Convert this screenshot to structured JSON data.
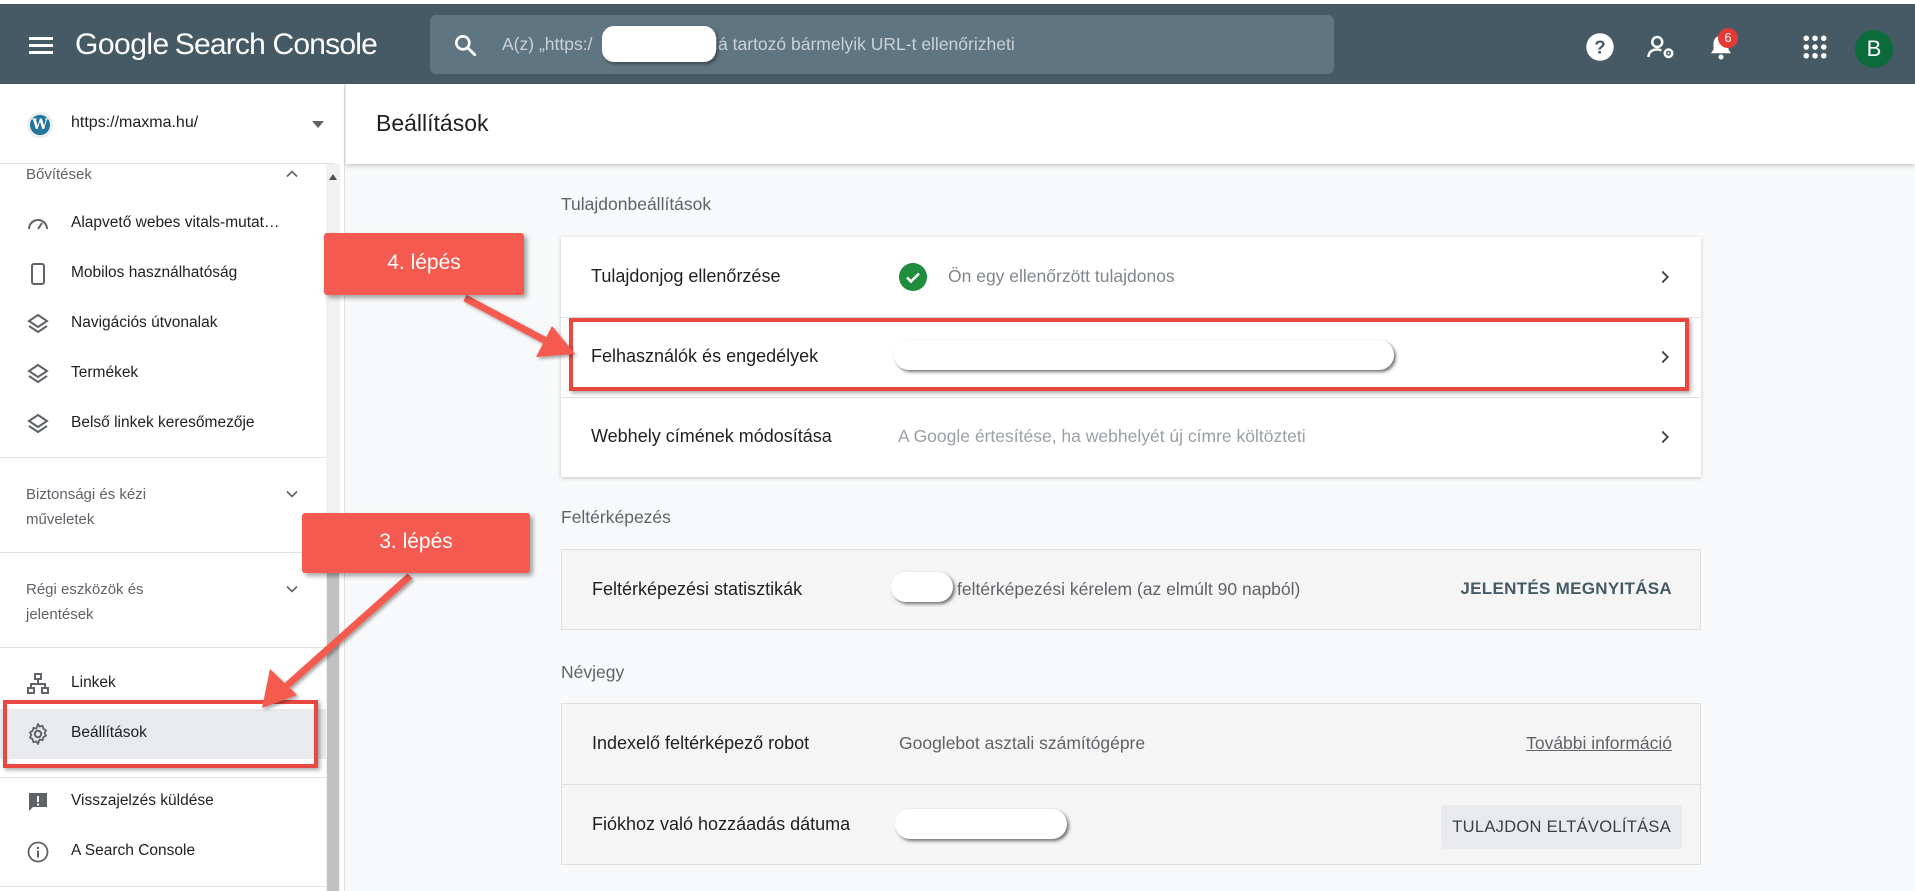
{
  "app": {
    "logo_google": "Google",
    "logo_product": "Search Console"
  },
  "search": {
    "placeholder_prefix": "A(z) „https:/",
    "placeholder_suffix": "alá tartozó bármelyik URL-t ellenőrizheti"
  },
  "header_icons": {
    "help": "help-icon",
    "admin": "user-settings-icon",
    "notifications": "bell-icon",
    "notification_count": "6",
    "apps": "apps-grid-icon",
    "avatar_letter": "B"
  },
  "sidebar": {
    "property_url": "https://maxma.hu/",
    "sections": {
      "extensions": "Bővítések",
      "security": "Biztonsági és kézi műveletek",
      "legacy": "Régi eszközök és jelentések"
    },
    "items": [
      {
        "label": "Alapvető webes vitals-mutat…",
        "icon": "speed-icon"
      },
      {
        "label": "Mobilos használhatóság",
        "icon": "phone-icon"
      },
      {
        "label": "Navigációs útvonalak",
        "icon": "layers-icon"
      },
      {
        "label": "Termékek",
        "icon": "layers-icon"
      },
      {
        "label": "Belső linkek keresőmezője",
        "icon": "layers-icon"
      },
      {
        "label": "Linkek",
        "icon": "sitemap-icon"
      },
      {
        "label": "Beállítások",
        "icon": "gear-icon",
        "active": true
      },
      {
        "label": "Visszajelzés küldése",
        "icon": "feedback-icon"
      },
      {
        "label": "A Search Console",
        "icon": "info-icon"
      }
    ]
  },
  "page": {
    "title": "Beállítások"
  },
  "groups": {
    "property": {
      "title": "Tulajdonbeállítások",
      "rows": [
        {
          "label": "Tulajdonjog ellenőrzése",
          "value": "Ön egy ellenőrzött tulajdonos"
        },
        {
          "label": "Felhasználók és engedélyek",
          "value": ""
        },
        {
          "label": "Webhely címének módosítása",
          "value": "A Google értesítése, ha webhelyét új címre költözteti"
        }
      ]
    },
    "crawl": {
      "title": "Feltérképezés",
      "rows": [
        {
          "label": "Feltérképezési statisztikák",
          "value": "feltérképezési kérelem (az elmúlt 90 napból)",
          "action": "JELENTÉS MEGNYITÁSA"
        }
      ]
    },
    "about": {
      "title": "Névjegy",
      "rows": [
        {
          "label": "Indexelő feltérképező robot",
          "value": "Googlebot asztali számítógépre",
          "link": "További információ"
        },
        {
          "label": "Fiókhoz való hozzáadás dátuma",
          "value": "",
          "action": "TULAJDON ELTÁVOLÍTÁSA"
        }
      ]
    }
  },
  "annotations": {
    "step3": "3. lépés",
    "step4": "4. lépés"
  },
  "colors": {
    "topbar": "#455a64",
    "search_bg": "#5f7581",
    "callout": "#f55a50",
    "highlight": "#e8483f",
    "check": "#1e8e3e"
  }
}
